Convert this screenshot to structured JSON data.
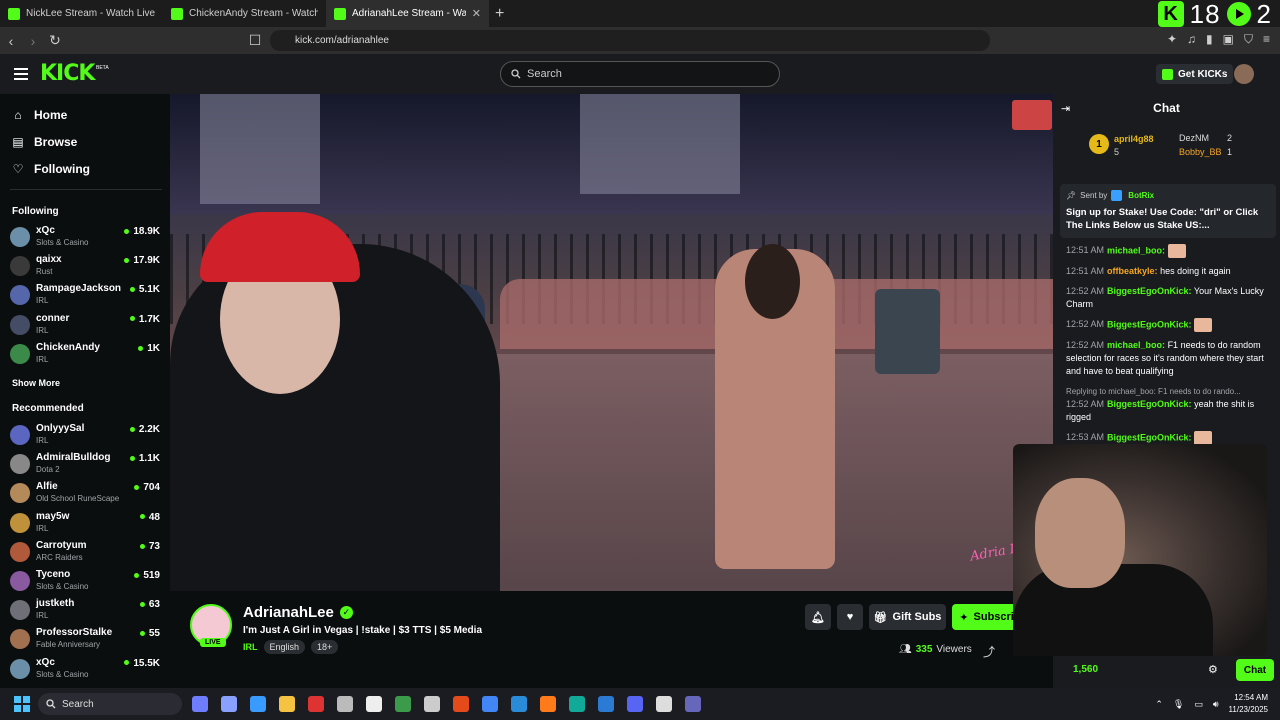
{
  "browser": {
    "tabs": [
      {
        "title": "NickLee Stream - Watch Live on Kick",
        "active": false
      },
      {
        "title": "ChickenAndy Stream - Watch Live",
        "active": false
      },
      {
        "title": "AdrianahLee Stream - Watch",
        "active": true
      }
    ],
    "new_tab": "+",
    "url": "kick.com/adrianahlee",
    "overlay_counts": [
      "18",
      "2"
    ]
  },
  "header": {
    "logo": "KICK",
    "beta": "BETA",
    "search_placeholder": "Search",
    "get_kicks_label": "Get KICKs"
  },
  "sidebar": {
    "nav": [
      {
        "label": "Home",
        "icon": "home-icon"
      },
      {
        "label": "Browse",
        "icon": "browse-icon"
      },
      {
        "label": "Following",
        "icon": "heart-icon"
      }
    ],
    "following_title": "Following",
    "following": [
      {
        "name": "xQc",
        "category": "Slots & Casino",
        "viewers": "18.9K",
        "color": "#6b8fa8"
      },
      {
        "name": "qaixx",
        "category": "Rust",
        "viewers": "17.9K",
        "color": "#3a3a3a"
      },
      {
        "name": "RampageJackson",
        "category": "IRL",
        "viewers": "5.1K",
        "color": "#5566aa"
      },
      {
        "name": "conner",
        "category": "IRL",
        "viewers": "1.7K",
        "color": "#444c66"
      },
      {
        "name": "ChickenAndy",
        "category": "IRL",
        "viewers": "1K",
        "color": "#3b8a4a"
      }
    ],
    "show_more": "Show More",
    "recommended_title": "Recommended",
    "recommended": [
      {
        "name": "OnlyyySal",
        "category": "IRL",
        "viewers": "2.2K",
        "color": "#5a66c0"
      },
      {
        "name": "AdmiralBulldog",
        "category": "Dota 2",
        "viewers": "1.1K",
        "color": "#888888"
      },
      {
        "name": "Alfie",
        "category": "Old School RuneScape",
        "viewers": "704",
        "color": "#b58a5b"
      },
      {
        "name": "may5w",
        "category": "IRL",
        "viewers": "48",
        "color": "#c0913b"
      },
      {
        "name": "Carrotyum",
        "category": "ARC Raiders",
        "viewers": "73",
        "color": "#b05a3b"
      },
      {
        "name": "Tyceno",
        "category": "Slots & Casino",
        "viewers": "519",
        "color": "#8a5aa0"
      },
      {
        "name": "justketh",
        "category": "IRL",
        "viewers": "63",
        "color": "#6f6f78"
      },
      {
        "name": "ProfessorStalke",
        "category": "Fable Anniversary",
        "viewers": "55",
        "color": "#a07050"
      },
      {
        "name": "xQc",
        "category": "Slots & Casino",
        "viewers": "15.5K",
        "color": "#6b8fa8"
      }
    ]
  },
  "video": {
    "watermark": "Adria Lee"
  },
  "stream": {
    "name": "AdrianahLee",
    "live": "LIVE",
    "title": "I'm Just A Girl  in Vegas | !stake | $3 TTS | $5 Media",
    "category": "IRL",
    "tags": [
      "English",
      "18+"
    ],
    "gift_subs": "Gift Subs",
    "subscribe": "Subscribe",
    "viewers": "335",
    "viewers_label": "Viewers"
  },
  "chat": {
    "title": "Chat",
    "leaderboard": {
      "rank1": {
        "name": "april4g88",
        "count": "5"
      },
      "second": {
        "name": "DezNM",
        "count": "2"
      },
      "third": {
        "name": "Bobby_BB",
        "count": "1"
      }
    },
    "pinned": {
      "sent_by": "Sent by",
      "sender": "BotRix",
      "text": "Sign up for Stake! Use Code: \"dri\" or Click The Links Below us Stake US:..."
    },
    "messages": [
      {
        "time": "12:51 AM",
        "user": "michael_boo:",
        "text": "",
        "emote": true
      },
      {
        "time": "12:51 AM",
        "user": "offbeatkyle:",
        "text": "hes doing it again",
        "orange": true
      },
      {
        "time": "12:52 AM",
        "user": "BiggestEgoOnKick:",
        "text": "Your Max's Lucky Charm"
      },
      {
        "time": "12:52 AM",
        "user": "BiggestEgoOnKick:",
        "text": "",
        "emote": true
      },
      {
        "time": "12:52 AM",
        "user": "michael_boo:",
        "text": "F1 needs to do random selection for races so it's random where they start and have to beat qualifying"
      },
      {
        "time": "12:52 AM",
        "user": "BiggestEgoOnKick:",
        "text": "yeah the shit is rigged",
        "reply": "Replying to michael_boo: F1 needs to do rando..."
      },
      {
        "time": "12:53 AM",
        "user": "BiggestEgoOnKick:",
        "text": "",
        "emote": true
      }
    ],
    "kicks_count": "1,560",
    "send_label": "Chat"
  },
  "taskbar": {
    "search_label": "Search",
    "time": "12:54 AM",
    "date": "11/23/2025"
  }
}
